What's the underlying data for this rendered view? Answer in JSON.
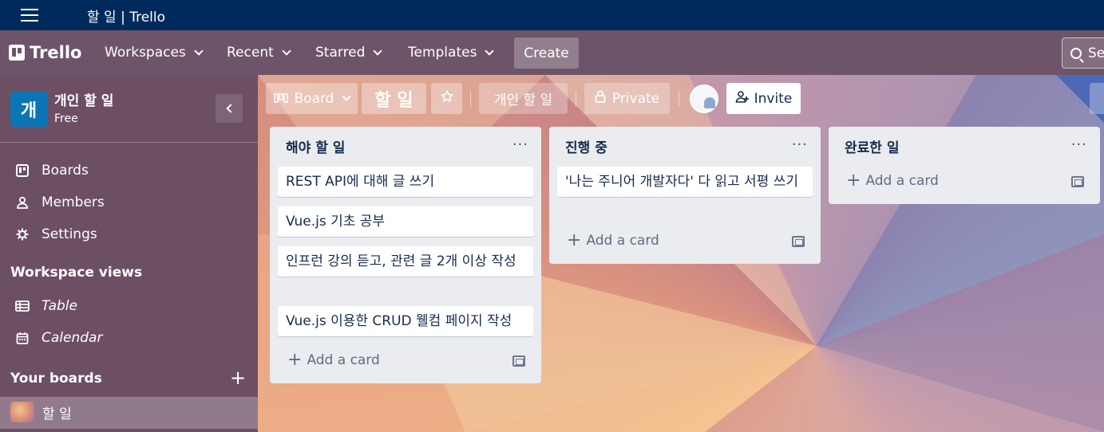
{
  "window": {
    "title": "할 일 | Trello"
  },
  "header": {
    "logo": "Trello",
    "nav": [
      "Workspaces",
      "Recent",
      "Starred",
      "Templates"
    ],
    "create": "Create",
    "search_placeholder": "Se"
  },
  "sidebar": {
    "workspace_initial": "개",
    "workspace_name": "개인 할 일",
    "workspace_plan": "Free",
    "items": [
      "Boards",
      "Members",
      "Settings"
    ],
    "views_heading": "Workspace views",
    "views": [
      "Table",
      "Calendar"
    ],
    "your_boards_heading": "Your boards",
    "boards": [
      "할 일"
    ]
  },
  "board": {
    "view_button": "Board",
    "name": "할 일",
    "workspace_button": "개인 할 일",
    "visibility": "Private",
    "invite": "Invite"
  },
  "lists": [
    {
      "title": "해야 할 일",
      "cards": [
        "REST API에 대해 글 쓰기",
        "Vue.js 기초 공부",
        "인프런 강의 듣고, 관련 글 2개 이상 작성",
        "Vue.js 이용한 CRUD 웰컴 페이지 작성"
      ],
      "add_label": "Add a card"
    },
    {
      "title": "진행 중",
      "cards": [
        "'나는 주니어 개발자다' 다 읽고 서평 쓰기"
      ],
      "add_label": "Add a card"
    },
    {
      "title": "완료한 일",
      "cards": [],
      "add_label": "Add a card"
    }
  ],
  "list_menu": "···",
  "colors": {
    "titlebar": "#002a5c",
    "header": "#6e5468",
    "sidebar": "#6c4f63",
    "list_bg": "#ebecf0",
    "workspace_avatar": "#0b76b5"
  }
}
